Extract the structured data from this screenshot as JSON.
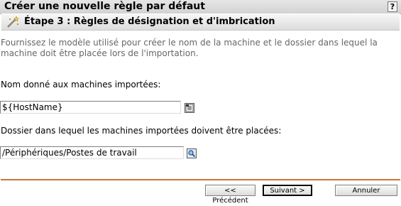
{
  "window": {
    "title": "Créer une nouvelle règle par défaut",
    "help_label": "?"
  },
  "step": {
    "title": "Étape 3 : Règles de désignation et d'imbrication"
  },
  "intro": "Fournissez le modèle utilisé pour créer le nom de la machine et le dossier dans lequel la machine doit être placée lors de l'importation.",
  "name_field": {
    "label": "Nom donné aux machines importées:",
    "value": "${HostName}"
  },
  "folder_field": {
    "label": "Dossier dans lequel les machines importées doivent être placées:",
    "value": "/Périphériques/Postes de travail"
  },
  "buttons": {
    "back": "<< Précédent",
    "next": "Suivant >",
    "cancel": "Annuler"
  },
  "colors": {
    "separator": "#c8743a",
    "intro_text": "#666666"
  }
}
